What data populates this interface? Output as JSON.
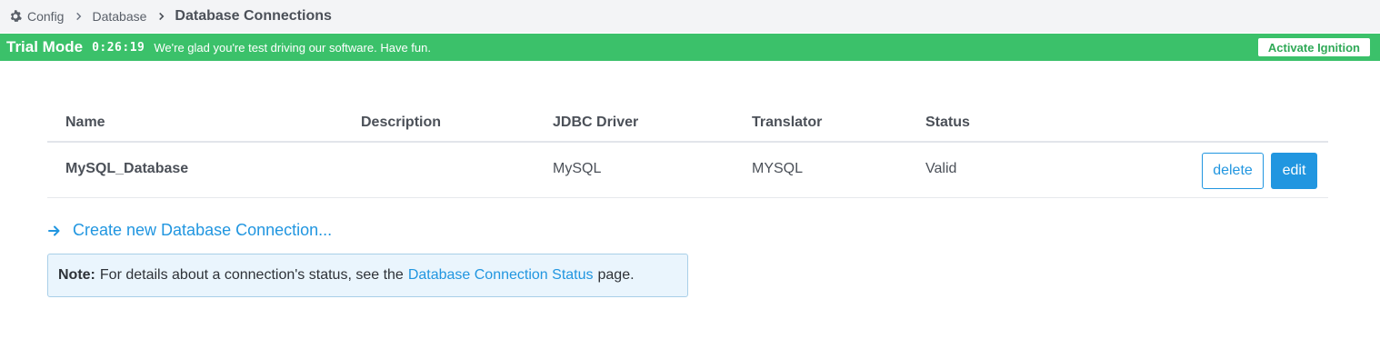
{
  "breadcrumb": {
    "items": [
      "Config",
      "Database"
    ],
    "current": "Database Connections",
    "icon": "gear-icon"
  },
  "trial": {
    "mode_label": "Trial Mode",
    "timer": "0:26:19",
    "message": "We're glad you're test driving our software. Have fun.",
    "activate_label": "Activate Ignition",
    "bg_color": "#3bc16a"
  },
  "table": {
    "headers": {
      "name": "Name",
      "description": "Description",
      "jdbc_driver": "JDBC Driver",
      "translator": "Translator",
      "status": "Status"
    },
    "rows": [
      {
        "name": "MySQL_Database",
        "description": "",
        "jdbc_driver": "MySQL",
        "translator": "MYSQL",
        "status": "Valid",
        "delete_label": "delete",
        "edit_label": "edit"
      }
    ]
  },
  "create_link": {
    "label": "Create new Database Connection...",
    "icon": "arrow-right-icon"
  },
  "note": {
    "bold": "Note:",
    "before_link": "For details about a connection's status, see the",
    "link": "Database Connection Status",
    "after_link": "page."
  },
  "colors": {
    "accent": "#2196e0",
    "note_bg": "#eaf5fd"
  }
}
